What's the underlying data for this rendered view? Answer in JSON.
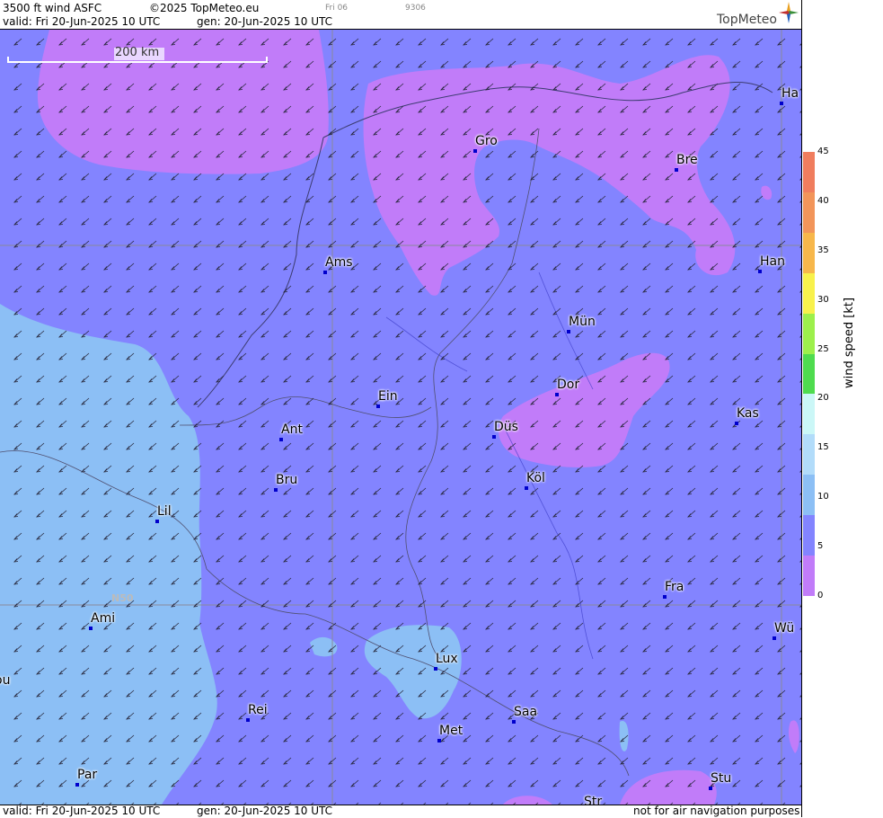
{
  "header": {
    "product": "3500 ft wind ASFC",
    "copyright": "©2025 TopMeteo.eu",
    "small_a": "Fri 06",
    "small_b": "9306",
    "valid": "valid:  Fri  20-Jun-2025  10 UTC",
    "gen": "gen: 20-Jun-2025 10 UTC",
    "logo": "TopMeteo"
  },
  "footer": {
    "valid": "valid:  Fri  20-Jun-2025  10 UTC",
    "gen": "gen: 20-Jun-2025 10 UTC",
    "disclaimer": "not for air navigation purposes"
  },
  "scale_bar": {
    "label": "200 km"
  },
  "grid_label": "N50",
  "colorbar": {
    "label": "wind  speed  [kt]",
    "ticks": [
      "45",
      "40",
      "35",
      "30",
      "25",
      "20",
      "15",
      "10",
      "5",
      "0"
    ],
    "colors": [
      "#f07d5e",
      "#f2955a",
      "#f7b74b",
      "#f8f14c",
      "#9df04c",
      "#4fdc4f",
      "#cbf7f7",
      "#b2dcfa",
      "#8cbff5",
      "#8384ff",
      "#c17cf9"
    ]
  },
  "cities": [
    {
      "name": "Gro"
    },
    {
      "name": "Bre"
    },
    {
      "name": "Ha"
    },
    {
      "name": "Ams"
    },
    {
      "name": "Han"
    },
    {
      "name": "Mün"
    },
    {
      "name": "Dor"
    },
    {
      "name": "Ein"
    },
    {
      "name": "Düs"
    },
    {
      "name": "Kas"
    },
    {
      "name": "Ant"
    },
    {
      "name": "Bru"
    },
    {
      "name": "Köl"
    },
    {
      "name": "Lil"
    },
    {
      "name": "Fra"
    },
    {
      "name": "Ami"
    },
    {
      "name": "Wü"
    },
    {
      "name": "Lux"
    },
    {
      "name": "ou"
    },
    {
      "name": "Rei"
    },
    {
      "name": "Saa"
    },
    {
      "name": "Met"
    },
    {
      "name": "Par"
    },
    {
      "name": "Stu"
    },
    {
      "name": "Str"
    }
  ],
  "wind": {
    "direction": "SW"
  }
}
